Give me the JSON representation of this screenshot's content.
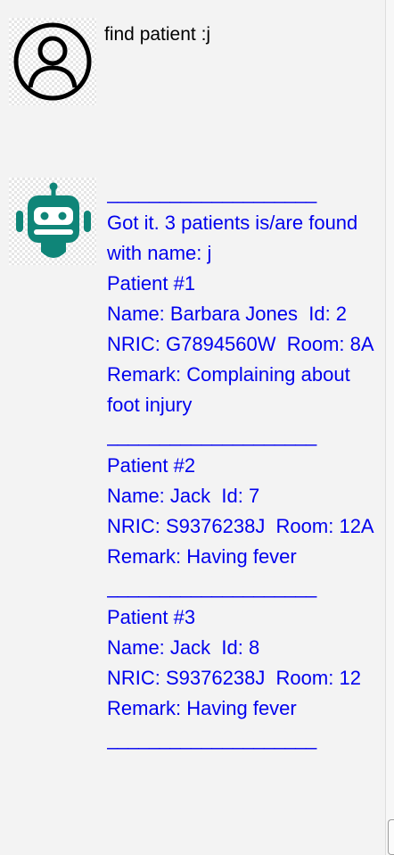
{
  "user": {
    "icon": "user-circle-icon",
    "message": "find patient :j"
  },
  "bot": {
    "icon": "robot-icon",
    "icon_color": "#0f8578",
    "text_color": "#0000ee",
    "separator": "____________________",
    "summary": "Got it. 3 patients is/are found with name: j",
    "patients": [
      {
        "header": "Patient #1",
        "name_line": "Name: Barbara Jones  Id: 2",
        "nric_line": "NRIC: G7894560W  Room: 8A",
        "remark_line": "Remark: Complaining about foot injury"
      },
      {
        "header": "Patient #2",
        "name_line": "Name: Jack  Id: 7",
        "nric_line": "NRIC: S9376238J  Room: 12A",
        "remark_line": "Remark: Having fever"
      },
      {
        "header": "Patient #3",
        "name_line": "Name: Jack  Id: 8",
        "nric_line": "NRIC: S9376238J  Room: 12",
        "remark_line": "Remark: Having fever"
      }
    ]
  }
}
